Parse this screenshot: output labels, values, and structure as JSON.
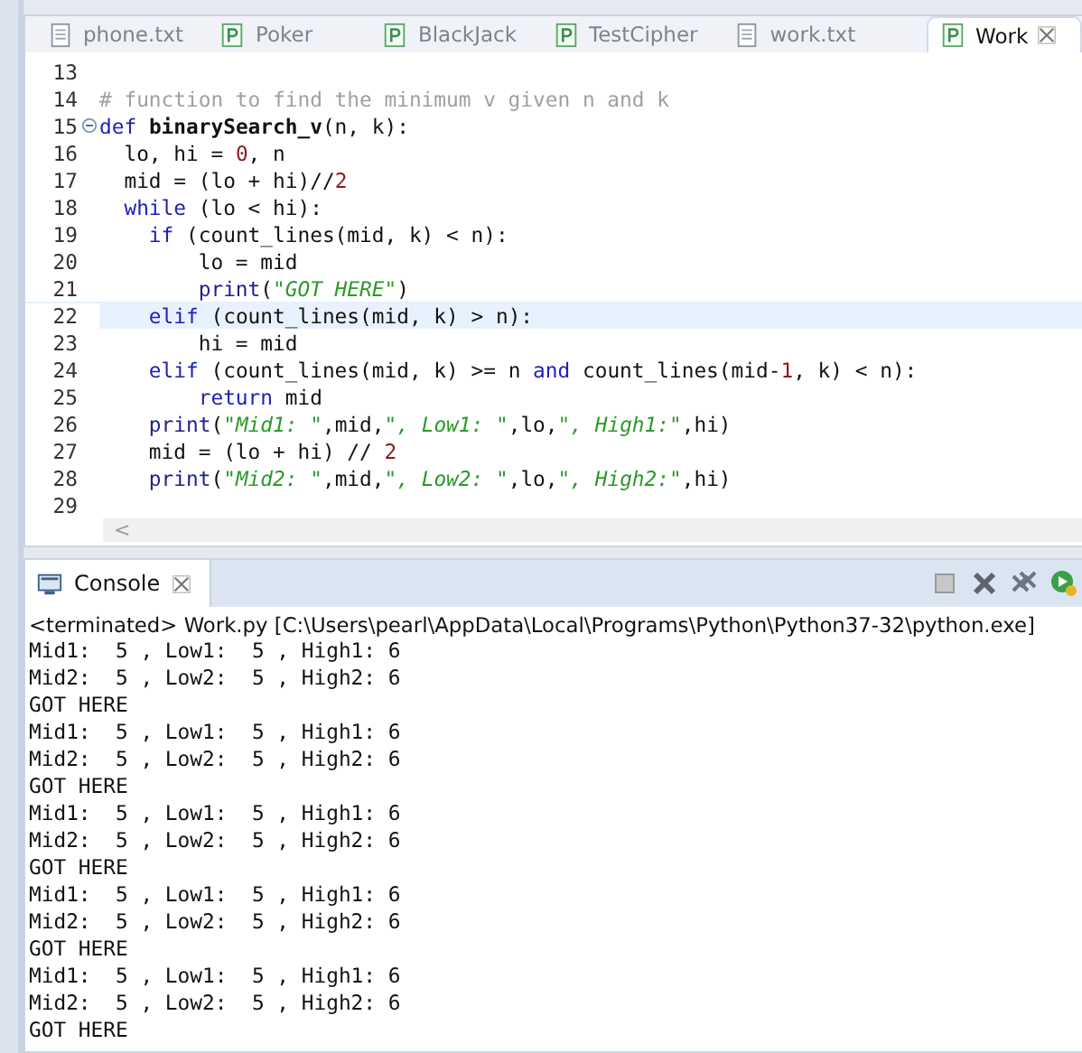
{
  "editor": {
    "tabs": [
      {
        "label": "phone.txt",
        "kind": "text",
        "selected": false
      },
      {
        "label": "Poker",
        "kind": "python",
        "selected": false
      },
      {
        "label": "BlackJack",
        "kind": "python",
        "selected": false
      },
      {
        "label": "TestCipher",
        "kind": "python",
        "selected": false
      },
      {
        "label": "work.txt",
        "kind": "text",
        "selected": false
      },
      {
        "label": "Work",
        "kind": "python",
        "selected": true
      }
    ],
    "lines": [
      {
        "number": "13",
        "current": false,
        "foldable": false
      },
      {
        "number": "14",
        "current": false,
        "foldable": false,
        "tokens": [
          {
            "kind": "comment",
            "text": "# function to find the minimum v given n and k"
          }
        ]
      },
      {
        "number": "15",
        "current": false,
        "foldable": true,
        "tokens": [
          {
            "kind": "keyword",
            "text": "def "
          },
          {
            "kind": "function",
            "text": "binarySearch_v"
          },
          {
            "kind": "plain",
            "text": "(n, k):"
          }
        ]
      },
      {
        "number": "16",
        "current": false,
        "foldable": false,
        "tokens": [
          {
            "kind": "plain",
            "text": "  lo, hi = "
          },
          {
            "kind": "number",
            "text": "0"
          },
          {
            "kind": "plain",
            "text": ", n"
          }
        ]
      },
      {
        "number": "17",
        "current": false,
        "foldable": false,
        "tokens": [
          {
            "kind": "plain",
            "text": "  mid = (lo + hi)//"
          },
          {
            "kind": "number",
            "text": "2"
          }
        ]
      },
      {
        "number": "18",
        "current": false,
        "foldable": false,
        "tokens": [
          {
            "kind": "keyword",
            "text": "  while"
          },
          {
            "kind": "plain",
            "text": " (lo < hi):"
          }
        ]
      },
      {
        "number": "19",
        "current": false,
        "foldable": false,
        "tokens": [
          {
            "kind": "keyword",
            "text": "    if"
          },
          {
            "kind": "plain",
            "text": " (count_lines(mid, k) < n):"
          }
        ]
      },
      {
        "number": "20",
        "current": false,
        "foldable": false,
        "tokens": [
          {
            "kind": "plain",
            "text": "        lo = mid"
          }
        ]
      },
      {
        "number": "21",
        "current": false,
        "foldable": false,
        "tokens": [
          {
            "kind": "builtin",
            "text": "        print"
          },
          {
            "kind": "plain",
            "text": "("
          },
          {
            "kind": "string",
            "text": "\"GOT HERE\""
          },
          {
            "kind": "plain",
            "text": ")"
          }
        ]
      },
      {
        "number": "22",
        "current": true,
        "foldable": false,
        "tokens": [
          {
            "kind": "keyword",
            "text": "    elif"
          },
          {
            "kind": "plain",
            "text": " (count_lines(mid, k) > n):"
          }
        ]
      },
      {
        "number": "23",
        "current": false,
        "foldable": false,
        "tokens": [
          {
            "kind": "plain",
            "text": "        hi = mid"
          }
        ]
      },
      {
        "number": "24",
        "current": false,
        "foldable": false,
        "tokens": [
          {
            "kind": "keyword",
            "text": "    elif"
          },
          {
            "kind": "plain",
            "text": " (count_lines(mid, k) >= n "
          },
          {
            "kind": "keyword",
            "text": "and"
          },
          {
            "kind": "plain",
            "text": " count_lines(mid-"
          },
          {
            "kind": "number",
            "text": "1"
          },
          {
            "kind": "plain",
            "text": ", k) < n):"
          }
        ]
      },
      {
        "number": "25",
        "current": false,
        "foldable": false,
        "tokens": [
          {
            "kind": "keyword",
            "text": "        return"
          },
          {
            "kind": "plain",
            "text": " mid"
          }
        ]
      },
      {
        "number": "26",
        "current": false,
        "foldable": false,
        "tokens": [
          {
            "kind": "builtin",
            "text": "    print"
          },
          {
            "kind": "plain",
            "text": "("
          },
          {
            "kind": "string",
            "text": "\"Mid1: \""
          },
          {
            "kind": "plain",
            "text": ",mid,"
          },
          {
            "kind": "string",
            "text": "\", Low1: \""
          },
          {
            "kind": "plain",
            "text": ",lo,"
          },
          {
            "kind": "string",
            "text": "\", High1:\""
          },
          {
            "kind": "plain",
            "text": ",hi)"
          }
        ]
      },
      {
        "number": "27",
        "current": false,
        "foldable": false,
        "tokens": [
          {
            "kind": "plain",
            "text": "    mid = (lo + hi) // "
          },
          {
            "kind": "number",
            "text": "2"
          }
        ]
      },
      {
        "number": "28",
        "current": false,
        "foldable": false,
        "tokens": [
          {
            "kind": "builtin",
            "text": "    print"
          },
          {
            "kind": "plain",
            "text": "("
          },
          {
            "kind": "string",
            "text": "\"Mid2: \""
          },
          {
            "kind": "plain",
            "text": ",mid,"
          },
          {
            "kind": "string",
            "text": "\", Low2: \""
          },
          {
            "kind": "plain",
            "text": ",lo,"
          },
          {
            "kind": "string",
            "text": "\", High2:\""
          },
          {
            "kind": "plain",
            "text": ",hi)"
          }
        ]
      },
      {
        "number": "29",
        "current": false,
        "foldable": false
      }
    ],
    "scroll_arrow": "<"
  },
  "console": {
    "tab": "Console",
    "status": "<terminated> Work.py [C:\\Users\\pearl\\AppData\\Local\\Programs\\Python\\Python37-32\\python.exe]",
    "output": [
      "Mid1:  5 , Low1:  5 , High1: 6",
      "Mid2:  5 , Low2:  5 , High2: 6",
      "GOT HERE",
      "Mid1:  5 , Low1:  5 , High1: 6",
      "Mid2:  5 , Low2:  5 , High2: 6",
      "GOT HERE",
      "Mid1:  5 , Low1:  5 , High1: 6",
      "Mid2:  5 , Low2:  5 , High2: 6",
      "GOT HERE",
      "Mid1:  5 , Low1:  5 , High1: 6",
      "Mid2:  5 , Low2:  5 , High2: 6",
      "GOT HERE",
      "Mid1:  5 , Low1:  5 , High1: 6",
      "Mid2:  5 , Low2:  5 , High2: 6",
      "GOT HERE"
    ]
  }
}
